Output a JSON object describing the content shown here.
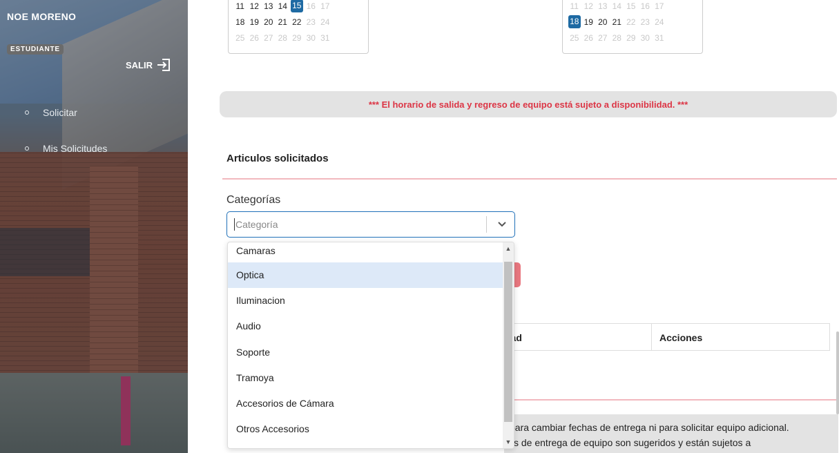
{
  "sidebar": {
    "user_name": "NOE MORENO",
    "role": "ESTUDIANTE",
    "logout_label": "SALIR",
    "items": [
      {
        "label": "Solicitar"
      },
      {
        "label": "Mis Solicitudes"
      }
    ]
  },
  "calendars": [
    {
      "rows": [
        [
          "11",
          "12",
          "13",
          "14",
          "15",
          "16",
          "17"
        ],
        [
          "18",
          "19",
          "20",
          "21",
          "22",
          "23",
          "24"
        ],
        [
          "25",
          "26",
          "27",
          "28",
          "29",
          "30",
          "31"
        ]
      ],
      "selected": "15"
    },
    {
      "rows": [
        [
          "11",
          "12",
          "13",
          "14",
          "15",
          "16",
          "17"
        ],
        [
          "18",
          "19",
          "20",
          "21",
          "22",
          "23",
          "24"
        ],
        [
          "25",
          "26",
          "27",
          "28",
          "29",
          "30",
          "31"
        ]
      ],
      "selected": "18"
    }
  ],
  "notice": "*** El horario de salida y regreso de equipo está sujeto a disponibilidad. ***",
  "section_title": "Articulos solicitados",
  "categories": {
    "label": "Categorías",
    "placeholder": "Categoría",
    "options": [
      "Camaras",
      "Optica",
      "Iluminacion",
      "Audio",
      "Soporte",
      "Tramoya",
      "Accesorios de Cámara",
      "Otros Accesorios"
    ],
    "highlighted": "Optica"
  },
  "table": {
    "headers": [
      "dad",
      "Acciones"
    ]
  },
  "info": {
    "line1": "para cambiar fechas de entrega ni para solicitar equipo adicional.",
    "line2": "s de entrega de equipo son sugeridos y están sujetos a"
  },
  "colors": {
    "accent_blue": "#1e6aa3",
    "notice_red": "#dc3545",
    "divider_pink": "#f2b8be"
  }
}
